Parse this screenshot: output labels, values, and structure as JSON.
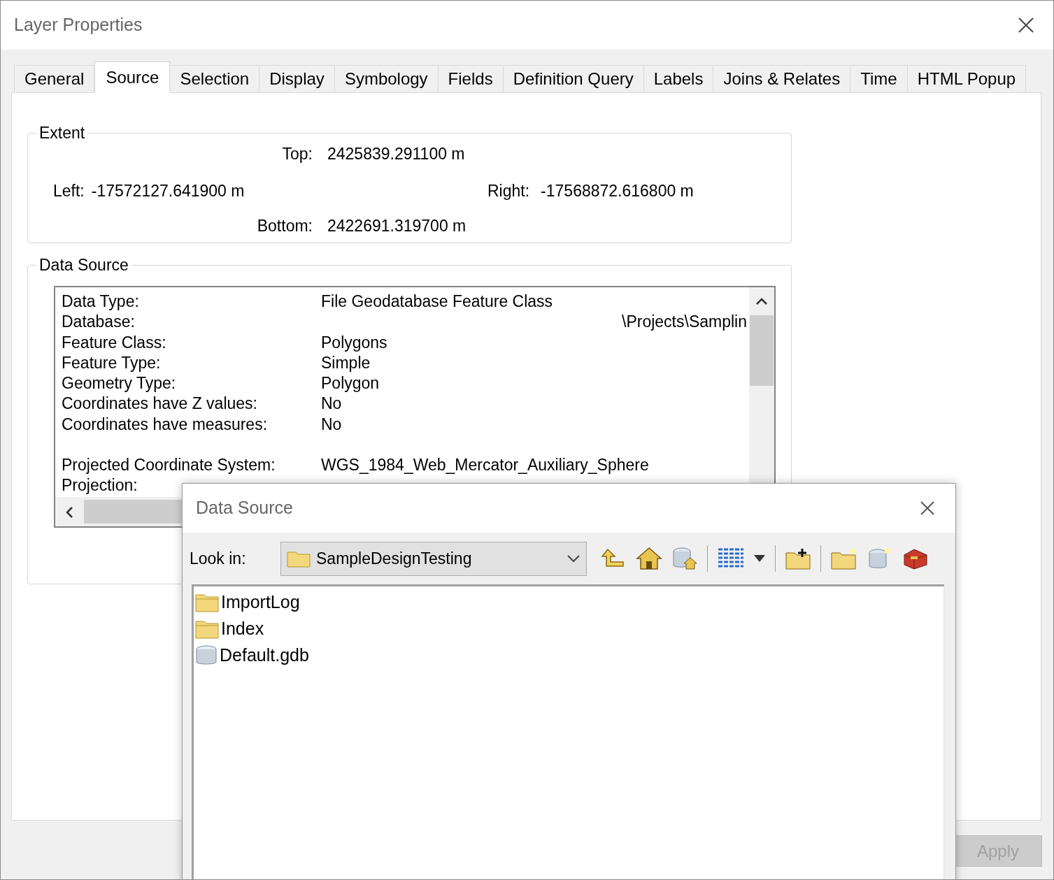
{
  "window": {
    "title": "Layer Properties"
  },
  "tabs": [
    {
      "label": "General",
      "selected": false
    },
    {
      "label": "Source",
      "selected": true
    },
    {
      "label": "Selection",
      "selected": false
    },
    {
      "label": "Display",
      "selected": false
    },
    {
      "label": "Symbology",
      "selected": false
    },
    {
      "label": "Fields",
      "selected": false
    },
    {
      "label": "Definition Query",
      "selected": false
    },
    {
      "label": "Labels",
      "selected": false
    },
    {
      "label": "Joins & Relates",
      "selected": false
    },
    {
      "label": "Time",
      "selected": false
    },
    {
      "label": "HTML Popup",
      "selected": false
    }
  ],
  "extent": {
    "title": "Extent",
    "top": {
      "label": "Top:",
      "value": "2425839.291100 m"
    },
    "left": {
      "label": "Left:",
      "value": "-17572127.641900 m"
    },
    "right": {
      "label": "Right:",
      "value": "-17568872.616800 m"
    },
    "bottom": {
      "label": "Bottom:",
      "value": "2422691.319700 m"
    }
  },
  "data_source": {
    "title": "Data Source",
    "rows": [
      {
        "kind": "pair",
        "label": "Data Type:",
        "value": "File Geodatabase Feature Class"
      },
      {
        "kind": "right",
        "label": "Database:",
        "value": "\\Projects\\Samplin"
      },
      {
        "kind": "pair",
        "label": "Feature Class:",
        "value": "Polygons"
      },
      {
        "kind": "pair",
        "label": "Feature Type:",
        "value": "Simple"
      },
      {
        "kind": "pair",
        "label": "Geometry Type:",
        "value": "Polygon"
      },
      {
        "kind": "pair",
        "label": "Coordinates have Z values:",
        "value": "No"
      },
      {
        "kind": "pair",
        "label": "Coordinates have measures:",
        "value": "No"
      },
      {
        "kind": "spaced",
        "label": "Projected Coordinate System:",
        "value": "WGS_1984_Web_Mercator_Auxiliary_Sphere"
      },
      {
        "kind": "label",
        "label": "Projection:"
      }
    ]
  },
  "apply_button": {
    "label": "Apply",
    "disabled": true
  },
  "dialog": {
    "title": "Data Source",
    "look_in": {
      "label": "Look in:",
      "value": "SampleDesignTesting"
    },
    "items": [
      {
        "kind": "folder",
        "name": "ImportLog"
      },
      {
        "kind": "folder",
        "name": "Index"
      },
      {
        "kind": "database",
        "name": "Default.gdb"
      }
    ]
  }
}
